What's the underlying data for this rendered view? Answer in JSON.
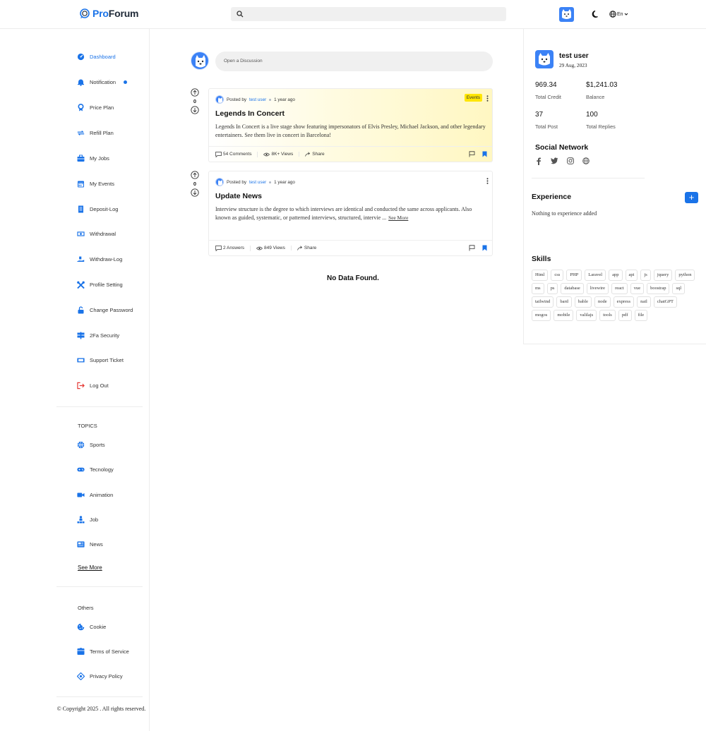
{
  "header": {
    "logo_prefix": "Pro",
    "logo_suffix": "Forum",
    "search_placeholder": "",
    "language": "En"
  },
  "sidebar": {
    "items": [
      {
        "label": "Dashboard",
        "icon": "dashboard-icon",
        "active": true
      },
      {
        "label": "Notification",
        "icon": "bell-icon",
        "dot": true
      },
      {
        "label": "Price Plan",
        "icon": "medal-icon"
      },
      {
        "label": "Refill Plan",
        "icon": "refresh-icon"
      },
      {
        "label": "My Jobs",
        "icon": "briefcase-icon"
      },
      {
        "label": "My Events",
        "icon": "calendar-icon"
      },
      {
        "label": "Deposit-Log",
        "icon": "receipt-icon"
      },
      {
        "label": "Withdrawal",
        "icon": "cash-icon"
      },
      {
        "label": "Withdraw-Log",
        "icon": "hand-cash-icon"
      },
      {
        "label": "Profile Setting",
        "icon": "tools-icon"
      },
      {
        "label": "Change Password",
        "icon": "lock-icon"
      },
      {
        "label": "2Fa Security",
        "icon": "signpost-icon"
      },
      {
        "label": "Support Ticket",
        "icon": "ticket-icon"
      },
      {
        "label": "Log Out",
        "icon": "logout-icon"
      }
    ],
    "topics_heading": "TOPICS",
    "topics": [
      {
        "label": "Sports",
        "icon": "basketball-icon"
      },
      {
        "label": "Tecnology",
        "icon": "gamepad-icon"
      },
      {
        "label": "Animation",
        "icon": "video-icon"
      },
      {
        "label": "Job",
        "icon": "org-chart-icon"
      },
      {
        "label": "News",
        "icon": "newspaper-icon"
      }
    ],
    "see_more": "See More",
    "others_heading": "Others",
    "others": [
      {
        "label": "Cookie",
        "icon": "cookie-icon"
      },
      {
        "label": "Terms of Service",
        "icon": "document-icon"
      },
      {
        "label": "Privacy Policy",
        "icon": "shield-icon"
      }
    ],
    "copyright": "© Copyright 2025 . All rights reserved."
  },
  "composer": {
    "placeholder": "Open a Discussion"
  },
  "posts": [
    {
      "votes": "0",
      "posted_by": "Posted by",
      "author": "test user",
      "time": "1 year ago",
      "badge": "Events",
      "title": "Legends In Concert",
      "body": "Legends In Concert is a live stage show featuring impersonators of Elvis Presley, Michael Jackson, and other legendary entertainers. See them live in concert in Barcelona!",
      "see_more": "",
      "stats": [
        "54 Comments",
        "8K+ Views",
        "Share"
      ]
    },
    {
      "votes": "0",
      "posted_by": "Posted by",
      "author": "test user",
      "time": "1 year ago",
      "badge": "",
      "title": "Update News",
      "body": "Interview structure is the degree to which interviews are identical and conducted the same across applicants. Also known as guided, systematic, or patterned interviews, structured, intervie ...",
      "see_more": "See More",
      "stats": [
        "2 Answers",
        "849 Views",
        "Share"
      ]
    }
  ],
  "no_data": "No Data Found.",
  "profile": {
    "name": "test user",
    "date": "29 Aug, 2023",
    "stats": [
      {
        "value": "969.34",
        "label": "Total Credit"
      },
      {
        "value": "$1,241.03",
        "label": "Balance"
      },
      {
        "value": "37",
        "label": "Total Post"
      },
      {
        "value": "100",
        "label": "Total Replies"
      }
    ],
    "social_heading": "Social Network",
    "social_icons": [
      "facebook-icon",
      "twitter-icon",
      "instagram-icon",
      "globe-icon"
    ],
    "experience_heading": "Experience",
    "experience_add": "+",
    "experience_empty": "Nothing to experience added",
    "skills_heading": "Skills",
    "skills": [
      "Html",
      "css",
      "PHP",
      "Laravel",
      "app",
      "api",
      "js",
      "jquery",
      "python",
      "ms",
      "ps",
      "database",
      "livewire",
      "react",
      "vue",
      "boostrap",
      "sql",
      "tailwind",
      "bard",
      "bable",
      "node",
      "express",
      "nail",
      "chatGPT",
      "mogos",
      "mobile",
      "valilajs",
      "tools",
      "pdf",
      "file"
    ]
  },
  "colors": {
    "accent": "#1a73e8",
    "badge": "#ffe600",
    "logout": "#e53935"
  }
}
